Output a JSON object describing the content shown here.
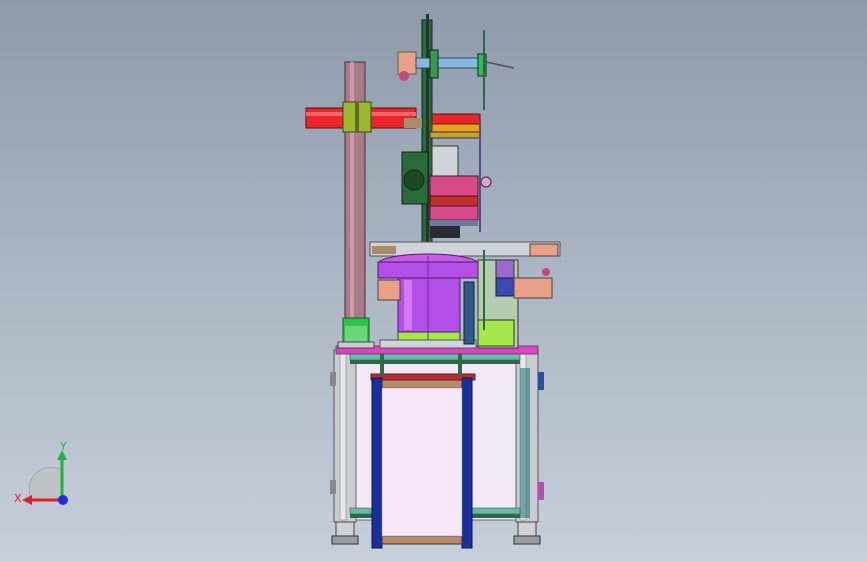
{
  "viewport": {
    "background_top": "#8e9aaa",
    "background_bottom": "#c7cfda"
  },
  "triad": {
    "x_label": "X",
    "y_label": "Y",
    "x_color": "#e0202a",
    "y_color": "#22b43c",
    "z_color": "#1c2fd8"
  },
  "model": {
    "frame_color": "#c9ccd2",
    "panel_color": "#f3e9f6",
    "rail_color": "#1a2f9c",
    "hopper_color": "#b24fe6",
    "column_color": "#a97a88",
    "arm_color": "#e8262a",
    "plate_color": "#2a6a3a"
  }
}
